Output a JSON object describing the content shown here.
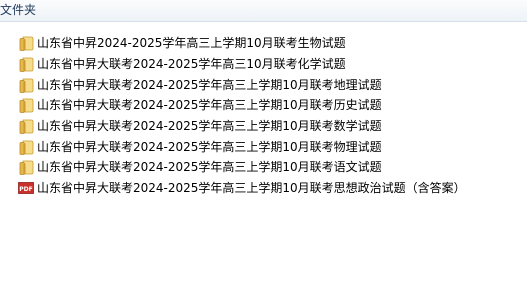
{
  "header": {
    "label": "文件夹"
  },
  "colors": {
    "folder": "#e6b84a",
    "pdf_red": "#c8302a"
  },
  "files": [
    {
      "name": "山东省中昇2024-2025学年高三上学期10月联考生物试题",
      "icon": "folder-icon"
    },
    {
      "name": "山东省中昇大联考2024-2025学年高三10月联考化学试题",
      "icon": "folder-icon"
    },
    {
      "name": "山东省中昇大联考2024-2025学年高三上学期10月联考地理试题",
      "icon": "folder-icon"
    },
    {
      "name": "山东省中昇大联考2024-2025学年高三上学期10月联考历史试题",
      "icon": "folder-icon"
    },
    {
      "name": "山东省中昇大联考2024-2025学年高三上学期10月联考数学试题",
      "icon": "folder-icon"
    },
    {
      "name": "山东省中昇大联考2024-2025学年高三上学期10月联考物理试题",
      "icon": "folder-icon"
    },
    {
      "name": "山东省中昇大联考2024-2025学年高三上学期10月联考语文试题",
      "icon": "folder-icon"
    },
    {
      "name": "山东省中昇大联考2024-2025学年高三上学期10月联考思想政治试题（含答案）",
      "icon": "pdf-icon",
      "icon_text": "PDF"
    }
  ]
}
